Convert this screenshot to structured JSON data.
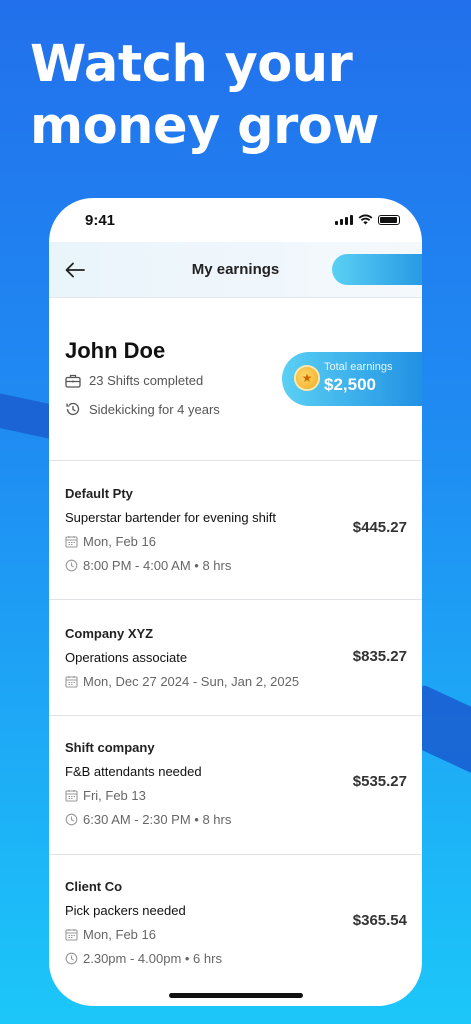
{
  "headline": {
    "line1": "Watch your",
    "line2": "money grow"
  },
  "status_bar": {
    "time": "9:41"
  },
  "nav": {
    "title": "My earnings"
  },
  "profile": {
    "name": "John Doe",
    "shifts_completed": "23 Shifts completed",
    "tenure": "Sidekicking for 4 years",
    "total_label": "Total earnings",
    "total_value": "$2,500"
  },
  "jobs": [
    {
      "company": "Default Pty",
      "title": "Superstar bartender for evening shift",
      "date": "Mon, Feb 16",
      "time": "8:00 PM - 4:00 AM • 8 hrs",
      "amount": "$445.27"
    },
    {
      "company": "Company XYZ",
      "title": "Operations associate",
      "date": "Mon, Dec 27 2024 - Sun, Jan 2, 2025",
      "time": "",
      "amount": "$835.27"
    },
    {
      "company": "Shift company",
      "title": "F&B attendants needed",
      "date": "Fri, Feb 13",
      "time": "6:30 AM - 2:30 PM • 8 hrs",
      "amount": "$535.27"
    },
    {
      "company": "Client Co",
      "title": "Pick packers needed",
      "date": "Mon, Feb 16",
      "time": "2.30pm - 4.00pm • 6 hrs",
      "amount": "$365.54"
    }
  ],
  "colors": {
    "background_top": "#2270ec",
    "background_bottom": "#1cc7f9",
    "accent": "#1f8fe2"
  }
}
